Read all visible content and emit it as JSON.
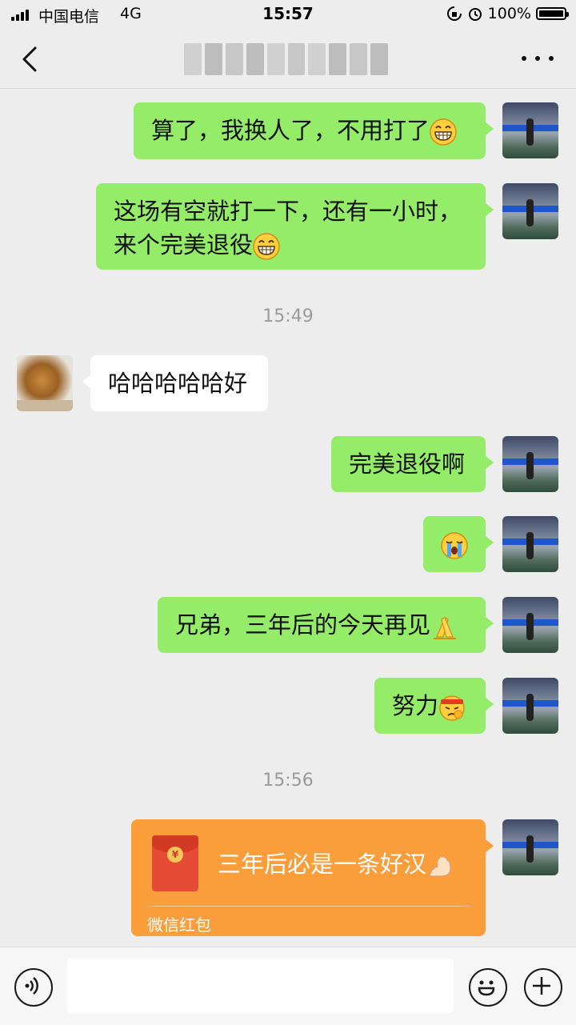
{
  "status_bar": {
    "carrier": "中国电信",
    "network": "4G",
    "time": "15:57",
    "battery_percent": "100%",
    "battery_level": 1.0
  },
  "nav": {
    "back_icon": "chevron-left-icon",
    "title_blurred": true,
    "more_icon": "ellipsis-icon"
  },
  "messages": [
    {
      "side": "right",
      "text": "算了，我换人了，不用打了",
      "emoji": "grin"
    },
    {
      "side": "right",
      "text": "这场有空就打一下，还有一小时，来个完美退役",
      "emoji": "grin"
    },
    {
      "side": "left",
      "text": "哈哈哈哈哈好"
    },
    {
      "side": "right",
      "text": "完美退役啊"
    },
    {
      "side": "right",
      "text": "",
      "emoji": "cry"
    },
    {
      "side": "right",
      "text": "兄弟，三年后的今天再见",
      "emoji": "pray"
    },
    {
      "side": "right",
      "text": "努力",
      "emoji": "fight"
    }
  ],
  "timestamps": [
    "15:49",
    "15:56"
  ],
  "red_packet": {
    "message": "三年后必是一条好汉",
    "emoji": "muscle",
    "label": "微信红包",
    "color": "#fa9d3b"
  },
  "input_bar": {
    "voice_icon": "voice-icon",
    "input_value": "",
    "emoji_icon": "smiley-icon",
    "plus_icon": "plus-icon"
  },
  "colors": {
    "background": "#ededed",
    "bubble_self": "#95ec69",
    "bubble_other": "#ffffff"
  }
}
